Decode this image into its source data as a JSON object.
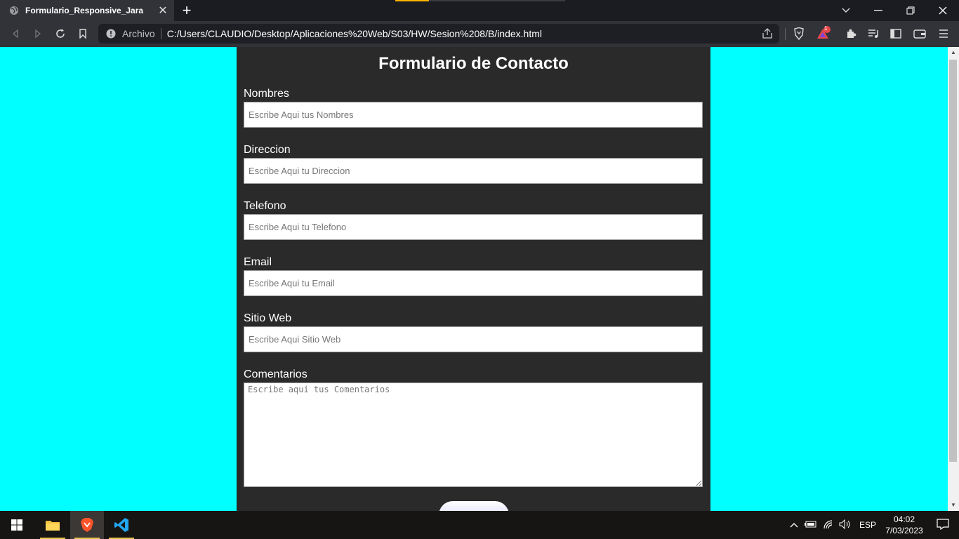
{
  "browser": {
    "tab_title": "Formulario_Responsive_Jara",
    "tab_close": "✕",
    "new_tab": "+",
    "url_scheme_label": "Archivo",
    "url": "C:/Users/CLAUDIO/Desktop/Aplicaciones%20Web/S03/HW/Sesion%208/B/index.html",
    "notification_badge": "1",
    "colors": {
      "chrome": "#323339",
      "tabbar": "#1b1c22"
    }
  },
  "form": {
    "title": "Formulario de Contacto",
    "fields": [
      {
        "label": "Nombres",
        "placeholder": "Escribe Aqui tus Nombres"
      },
      {
        "label": "Direccion",
        "placeholder": "Escribe Aqui tu Direccion"
      },
      {
        "label": "Telefono",
        "placeholder": "Escribe Aqui tu Telefono"
      },
      {
        "label": "Email",
        "placeholder": "Escribe Aqui tu Email"
      },
      {
        "label": "Sitio Web",
        "placeholder": "Escribe Aqui Sitio Web"
      }
    ],
    "comments": {
      "label": "Comentarios",
      "placeholder": "Escribe aqui tus Comentarios"
    },
    "submit_label": "",
    "colors": {
      "page_bg": "#00ffff",
      "card_bg": "#2a2a2a"
    }
  },
  "taskbar": {
    "apps": [
      "file-explorer",
      "brave-browser",
      "vscode"
    ],
    "language": "ESP",
    "time": "04:02",
    "date": "7/03/2023"
  }
}
